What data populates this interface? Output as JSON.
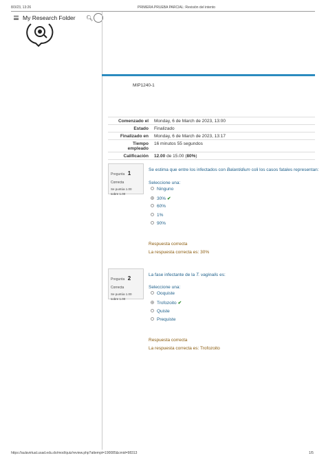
{
  "print_header": {
    "date": "8/3/23, 13:26",
    "title": "PRIMERA PRUEBA PARCIAL: Revisión del intento"
  },
  "appbar": {
    "menu_icon": "hamburger-icon",
    "folder_title": "My Research Folder",
    "search_icon": "search-icon"
  },
  "course": "MIP1240-1",
  "summary": {
    "rows": [
      {
        "label": "Comenzado el",
        "value": "Monday, 6 de March de 2023, 13:00"
      },
      {
        "label": "Estado",
        "value": "Finalizado"
      },
      {
        "label": "Finalizado en",
        "value": "Monday, 6 de March de 2023, 13:17"
      },
      {
        "label": "Tiempo empleado",
        "value": "16 minutos 55 segundos"
      }
    ],
    "grade_label": "Calificación",
    "grade_value": "12.00",
    "grade_rest": " de 15.00 (",
    "grade_pct": "80%",
    "grade_end": ")"
  },
  "questions": [
    {
      "prefix": "Pregunta",
      "number": "1",
      "state": "Correcta",
      "mark_line1": "Se puntúa 1.00",
      "mark_line2": "sobre 1.00",
      "text_before": "Se estima que entre los infectados con ",
      "text_italic": "Balantidium",
      "text_after": " coli los casos fatales representan:",
      "select_label": "Seleccione una:",
      "options": [
        "Ninguno",
        "30%",
        "60%",
        "1%",
        "90%"
      ],
      "selected_index": 1,
      "feedback_state": "Respuesta correcta",
      "feedback_answer": "La respuesta correcta es: 30%"
    },
    {
      "prefix": "Pregunta",
      "number": "2",
      "state": "Correcta",
      "mark_line1": "Se puntúa 1.00",
      "mark_line2": "sobre 1.00",
      "text_before": "La fase infectante de la ",
      "text_italic": "T. vaginalis",
      "text_after": " es:",
      "select_label": "Seleccione una:",
      "options": [
        "Ooquiste",
        "Trofozoito",
        "Quiste",
        "Prequiste"
      ],
      "selected_index": 1,
      "feedback_state": "Respuesta correcta",
      "feedback_answer": "La respuesta correcta es: Trofozoito"
    }
  ],
  "colors": {
    "accent_bar": "#2b8bbf",
    "question_text": "#1d5f8a",
    "feedback": "#8a5a0c",
    "check": "#2e8b2e"
  },
  "footer": {
    "url": "https://aulavirtual.usad.edu.do/mod/quiz/review.php?attempt=190085&cmid=98313",
    "page": "1/5"
  }
}
